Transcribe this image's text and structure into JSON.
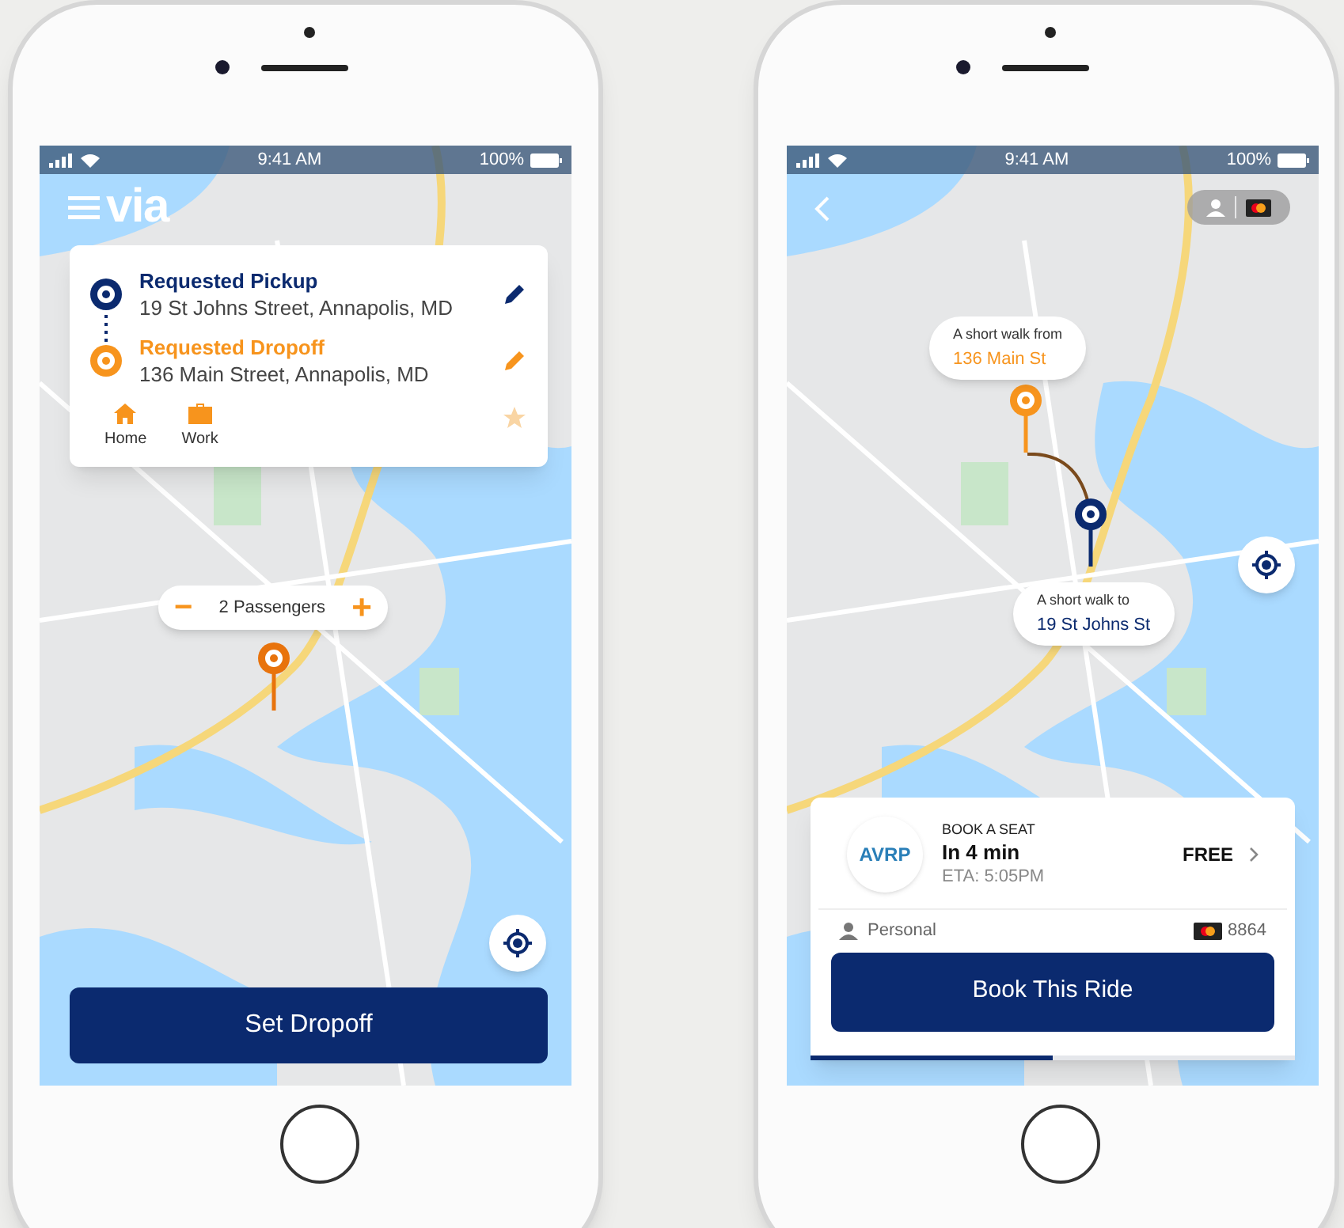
{
  "request_screen": {
    "status_bar": {
      "time": "9:41 AM",
      "battery": "100%"
    },
    "logo": "via",
    "stops": [
      {
        "kind": "pickup",
        "label": "Requested Pickup",
        "address": "19 St Johns Street, Annapolis, MD"
      },
      {
        "kind": "dropoff",
        "label": "Requested Dropoff",
        "address": "136 Main Street, Annapolis, MD"
      }
    ],
    "shortcuts": [
      {
        "kind": "home",
        "label": "Home"
      },
      {
        "kind": "work",
        "label": "Work"
      }
    ],
    "passengers": {
      "decrease": "−",
      "label": "2 Passengers",
      "increase": "+"
    },
    "primary_button": "Set Dropoff"
  },
  "booking_screen": {
    "status_bar": {
      "time": "9:41 AM",
      "battery": "100%"
    },
    "walk_bubbles": [
      {
        "kind": "dropoff",
        "caption": "A short walk from",
        "place": "136 Main St"
      },
      {
        "kind": "pickup",
        "caption": "A short walk to",
        "place": "19 St Johns St"
      }
    ],
    "ride_card": {
      "logo": "AVRP",
      "overline": "BOOK A SEAT",
      "arrival": "In 4 min",
      "eta": "ETA: 5:05PM",
      "price": "FREE",
      "profile": "Personal",
      "card_number": "8864",
      "book_button": "Book This Ride",
      "level": 0.5
    }
  }
}
